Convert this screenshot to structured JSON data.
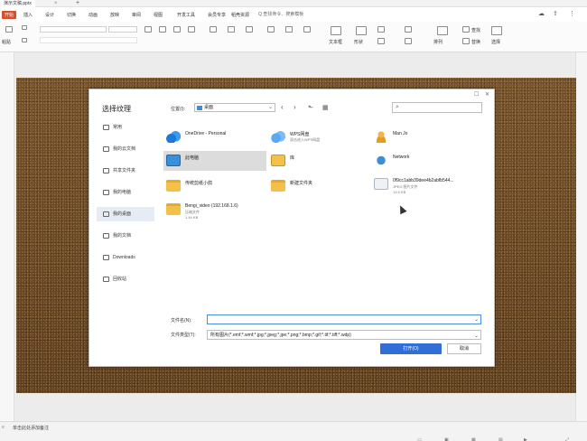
{
  "app": {
    "doc_tab": "演示文稿.pptx",
    "tab_close": "×",
    "tab_add": "+"
  },
  "menu": {
    "items": [
      "开始",
      "插入",
      "设计",
      "切换",
      "动画",
      "放映",
      "审阅",
      "视图",
      "开发工具",
      "会员专享",
      "稻壳资源"
    ],
    "search": "Q 查找命令、搜索模板"
  },
  "ribbon": {
    "labels": [
      "粘贴",
      "剪切",
      "格式刷",
      "文本框",
      "形状",
      "排列",
      "查找",
      "替换",
      "选择"
    ]
  },
  "dialog": {
    "title": "选择纹理",
    "nav": [
      "常用",
      "我的云文档",
      "共享文件夹",
      "我的电脑",
      "我的桌面",
      "我的文档",
      "Downloads",
      "回收站"
    ],
    "location_label": "位置(I):",
    "location_value": "桌面",
    "items": [
      {
        "name": "OneDrive - Personal",
        "icon": "onedrive-icon"
      },
      {
        "name": "WPS网盘",
        "sub": "双击进入WPS网盘",
        "icon": "wps-cloud-icon"
      },
      {
        "name": "Man Jo",
        "icon": "user-folder-icon"
      },
      {
        "name": "此电脑",
        "icon": "desktop-icon"
      },
      {
        "name": "库",
        "icon": "library-icon"
      },
      {
        "name": "Network",
        "icon": "network-icon"
      },
      {
        "name": "传统剪纸小鸽",
        "icon": "folder-icon"
      },
      {
        "name": "新建文件夹",
        "icon": "folder-icon"
      },
      {
        "name": "0f9cc1abb39dee4b2abfb544...",
        "sub": "JPEG 图片文件",
        "sub2": "13.5 KB",
        "icon": "image-file-icon"
      },
      {
        "name": "Bengi_video (192.168.1.6)",
        "sub": "压缩文件",
        "sub2": "1.44 KB",
        "icon": "shared-folder-icon"
      }
    ],
    "filename_label": "文件名(N):",
    "filename_value": "",
    "filetype_label": "文件类型(T):",
    "filetype_value": "所有图片(*.emf;*.wmf;*.jpg;*.jpeg;*.jpe;*.png;*.bmp;*.gif;*.tif;*.tiff;*.wdp)",
    "open_label": "打开(O)",
    "cancel_label": "取消"
  },
  "status": {
    "text": "单击此处添加备注"
  }
}
